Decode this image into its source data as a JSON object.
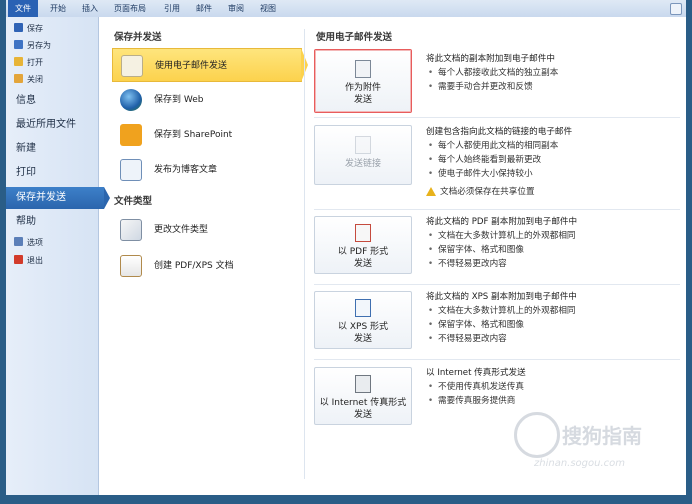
{
  "ribbon": {
    "tabs": [
      "文件",
      "开始",
      "插入",
      "页面布局",
      "引用",
      "邮件",
      "审阅",
      "视图"
    ]
  },
  "leftnav": {
    "quick": [
      {
        "label": "保存",
        "icon": "save-icon",
        "color": "#2f63b5"
      },
      {
        "label": "另存为",
        "icon": "save-as-icon",
        "color": "#3f74c4"
      },
      {
        "label": "打开",
        "icon": "open-folder-icon",
        "color": "#e7b437"
      },
      {
        "label": "关闭",
        "icon": "close-doc-icon",
        "color": "#e3a53a"
      }
    ],
    "items": [
      "信息",
      "最近所用文件",
      "新建",
      "打印",
      "保存并发送",
      "帮助"
    ],
    "bottom": [
      {
        "label": "选项",
        "icon": "options-icon",
        "color": "#5b7fb8"
      },
      {
        "label": "退出",
        "icon": "exit-icon",
        "color": "#d23b2b"
      }
    ]
  },
  "middle": {
    "section1": "保存并发送",
    "items1": [
      {
        "label": "使用电子邮件发送",
        "icon": "email-doc-icon",
        "selected": true
      },
      {
        "label": "保存到 Web",
        "icon": "globe-icon"
      },
      {
        "label": "保存到 SharePoint",
        "icon": "sharepoint-icon"
      },
      {
        "label": "发布为博客文章",
        "icon": "blog-icon"
      }
    ],
    "section2": "文件类型",
    "items2": [
      {
        "label": "更改文件类型",
        "icon": "change-type-icon"
      },
      {
        "label": "创建 PDF/XPS 文档",
        "icon": "pdf-xps-icon"
      }
    ]
  },
  "right": {
    "title": "使用电子邮件发送",
    "options": [
      {
        "button": [
          "作为附件",
          "发送"
        ],
        "icon": "attachment-icon",
        "highlight": true,
        "heading": "将此文档的副本附加到电子邮件中",
        "bullets": [
          "每个人都接收此文档的独立副本",
          "需要手动合并更改和反馈"
        ]
      },
      {
        "button": [
          "发送链接"
        ],
        "icon": "link-icon",
        "disabled": true,
        "heading": "创建包含指向此文档的链接的电子邮件",
        "bullets": [
          "每个人都使用此文档的相同副本",
          "每个人始终能看到最新更改",
          "使电子邮件大小保持较小"
        ],
        "warning": "文档必须保存在共享位置"
      },
      {
        "button": [
          "以 PDF 形式",
          "发送"
        ],
        "icon": "pdf-icon",
        "heading": "将此文档的 PDF 副本附加到电子邮件中",
        "bullets": [
          "文档在大多数计算机上的外观都相同",
          "保留字体、格式和图像",
          "不得轻易更改内容"
        ]
      },
      {
        "button": [
          "以 XPS 形式",
          "发送"
        ],
        "icon": "xps-icon",
        "heading": "将此文档的 XPS 副本附加到电子邮件中",
        "bullets": [
          "文档在大多数计算机上的外观都相同",
          "保留字体、格式和图像",
          "不得轻易更改内容"
        ]
      },
      {
        "button": [
          "以 Internet 传真形式",
          "发送"
        ],
        "icon": "fax-icon",
        "heading": "以 Internet 传真形式发送",
        "bullets": [
          "不使用传真机发送传真",
          "需要传真服务提供商"
        ]
      }
    ]
  },
  "watermark": {
    "text": "搜狗指南",
    "url": "zhinan.sogou.com"
  }
}
